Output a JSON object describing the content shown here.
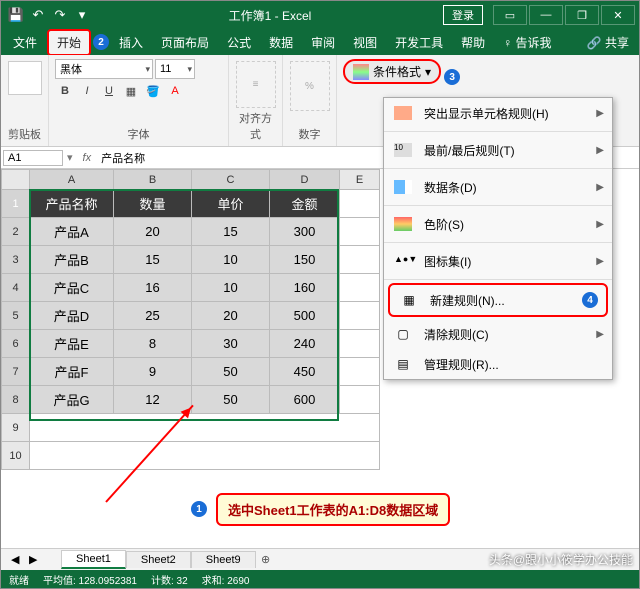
{
  "title": "工作簿1 - Excel",
  "login": "登录",
  "win": {
    "min": "—",
    "max": "❐",
    "close": "✕",
    "help": "?",
    "ropt": "▭"
  },
  "qat": {
    "save": "💾",
    "undo": "↶",
    "redo": "↷",
    "more": "▾"
  },
  "tabs": {
    "file": "文件",
    "home": "开始",
    "insert": "插入",
    "layout": "页面布局",
    "formulas": "公式",
    "data": "数据",
    "review": "审阅",
    "view": "视图",
    "dev": "开发工具",
    "help": "帮助",
    "tell": "♀ 告诉我",
    "share": "🔗 共享"
  },
  "markers": {
    "m1": "1",
    "m2": "2",
    "m3": "3",
    "m4": "4"
  },
  "ribbon": {
    "clip_label": "剪贴板",
    "font_label": "字体",
    "align_label": "对齐方式",
    "num_label": "数字",
    "font_name": "黑体",
    "font_size": "11",
    "cf_label": "条件格式"
  },
  "namebox": {
    "cell": "A1",
    "fx": "fx",
    "val": "产品名称"
  },
  "cols": [
    "A",
    "B",
    "C",
    "D",
    "E"
  ],
  "rows": [
    "1",
    "2",
    "3",
    "4",
    "5",
    "6",
    "7",
    "8",
    "9",
    "10"
  ],
  "header": [
    "产品名称",
    "数量",
    "单价",
    "金额"
  ],
  "data": [
    [
      "产品A",
      "20",
      "15",
      "300"
    ],
    [
      "产品B",
      "15",
      "10",
      "150"
    ],
    [
      "产品C",
      "16",
      "10",
      "160"
    ],
    [
      "产品D",
      "25",
      "20",
      "500"
    ],
    [
      "产品E",
      "8",
      "30",
      "240"
    ],
    [
      "产品F",
      "9",
      "50",
      "450"
    ],
    [
      "产品G",
      "12",
      "50",
      "600"
    ]
  ],
  "menu": {
    "highlight": "突出显示单元格规则(H)",
    "topbottom": "最前/最后规则(T)",
    "databars": "数据条(D)",
    "colorscales": "色阶(S)",
    "iconsets": "图标集(I)",
    "newrule": "新建规则(N)...",
    "clear": "清除规则(C)",
    "manage": "管理规则(R)..."
  },
  "callout": "选中Sheet1工作表的A1:D8数据区域",
  "sheets": {
    "s1": "Sheet1",
    "s2": "Sheet2",
    "s9": "Sheet9",
    "plus": "⊕"
  },
  "status": {
    "ready": "就绪",
    "avg": "平均值: 128.0952381",
    "count": "计数: 32",
    "sum": "求和: 2690"
  },
  "watermark": "头条@跟小小筱学办公技能"
}
